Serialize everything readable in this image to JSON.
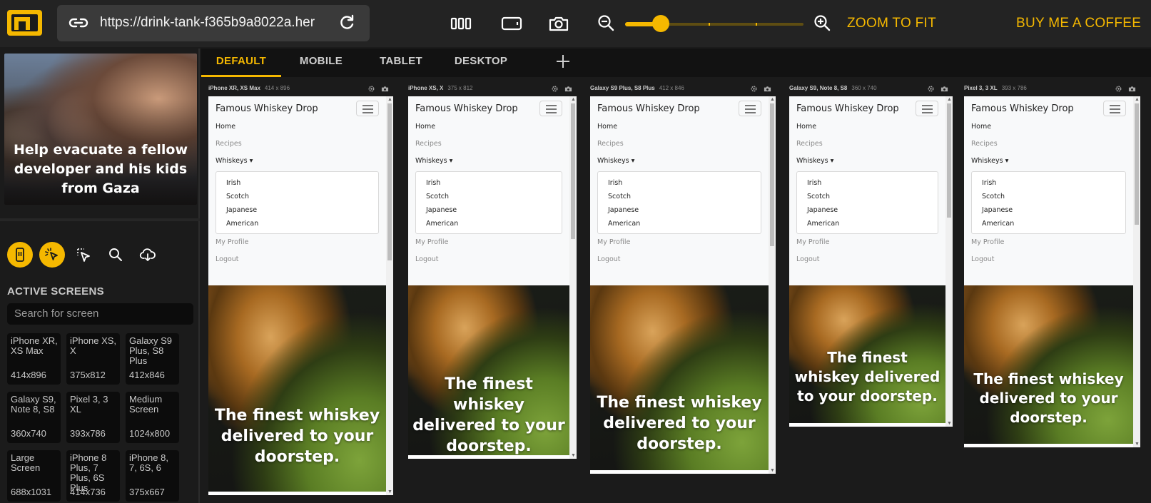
{
  "app": {
    "url": "https://drink-tank-f365b9a8022a.her",
    "zoom_to_fit": "ZOOM TO FIT",
    "buy_coffee": "BUY ME A COFFEE",
    "zoom_level": 0.2,
    "accent": "#f5b800"
  },
  "sidebar": {
    "banner_text": "Help evacuate a fellow developer and his kids from Gaza",
    "section_title": "ACTIVE SCREENS",
    "search_placeholder": "Search for screen",
    "screens": [
      {
        "name": "iPhone XR, XS Max",
        "res": "414x896"
      },
      {
        "name": "iPhone XS, X",
        "res": "375x812"
      },
      {
        "name": "Galaxy S9 Plus, S8 Plus",
        "res": "412x846"
      },
      {
        "name": "Galaxy S9, Note 8, S8",
        "res": "360x740"
      },
      {
        "name": "Pixel 3, 3 XL",
        "res": "393x786"
      },
      {
        "name": "Medium Screen",
        "res": "1024x800"
      },
      {
        "name": "Large Screen",
        "res": "688x1031"
      },
      {
        "name": "iPhone 8 Plus, 7 Plus, 6S Plus",
        "res": "414x736"
      },
      {
        "name": "iPhone 8, 7, 6S, 6",
        "res": "375x667"
      }
    ]
  },
  "tabs": [
    "DEFAULT",
    "MOBILE",
    "TABLET",
    "DESKTOP"
  ],
  "site": {
    "brand": "Famous Whiskey Drop",
    "nav": [
      "Home",
      "Recipes",
      "Whiskeys"
    ],
    "dropdown": [
      "Irish",
      "Scotch",
      "Japanese",
      "American"
    ],
    "nav2": [
      "My Profile",
      "Logout"
    ],
    "hero": "The finest whiskey delivered to your doorstep."
  },
  "devices": [
    {
      "name": "iPhone XR, XS Max",
      "size": "414 x 896"
    },
    {
      "name": "iPhone XS, X",
      "size": "375 x 812"
    },
    {
      "name": "Galaxy S9 Plus, S8 Plus",
      "size": "412 x 846"
    },
    {
      "name": "Galaxy S9, Note 8, S8",
      "size": "360 x 740"
    },
    {
      "name": "Pixel 3, 3 XL",
      "size": "393 x 786"
    }
  ]
}
